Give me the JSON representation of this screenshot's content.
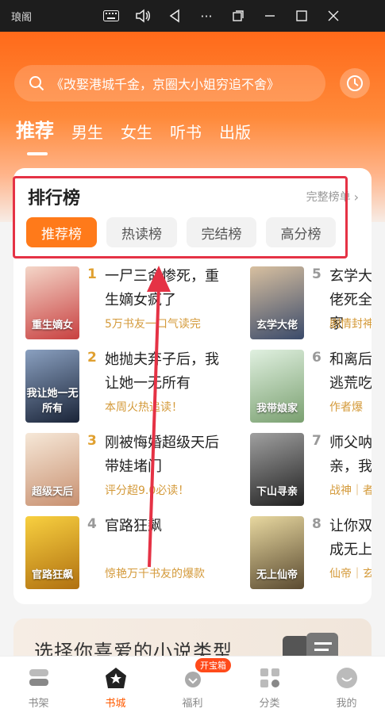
{
  "window": {
    "title": "琅阁",
    "buttons": {
      "keyboard": "keyboard-icon",
      "volume": "volume-icon",
      "back": "back-icon",
      "more": "···",
      "restore": "restore-icon",
      "minimize": "minimize-icon",
      "maximize": "maximize-icon",
      "close": "close-icon"
    }
  },
  "search": {
    "placeholder": "《改娶港城千金，京圈大小姐穷追不舍》"
  },
  "tabs": [
    "推荐",
    "男生",
    "女生",
    "听书",
    "出版"
  ],
  "ranking": {
    "title": "排行榜",
    "full_link": "完整榜单",
    "chips": [
      "推荐榜",
      "热读榜",
      "完结榜",
      "高分榜"
    ],
    "books": [
      {
        "rank": "1",
        "title": "一尸三命惨死，重生嫡女疯了",
        "tag": "5万书友一口气读完",
        "cover_text": "重生嫡女",
        "cover_color": "#c84040"
      },
      {
        "rank": "2",
        "title": "她抛夫弃子后，我让她一无所有",
        "tag": "本周火热追读！",
        "cover_text": "我让她一无所有",
        "cover_color": "#2a3a58"
      },
      {
        "rank": "3",
        "title": "刚被悔婚超级天后带娃堵门",
        "tag": "评分超9.0必读！",
        "cover_text": "超级天后",
        "cover_color": "#c89070"
      },
      {
        "rank": "4",
        "title": "官路狂飙",
        "tag": "惊艳万千书友的爆款",
        "cover_text": "官路狂飙",
        "cover_color": "#e0b020"
      },
      {
        "rank": "5",
        "title": "玄学大佬死全家",
        "tag": "剧情封神",
        "cover_text": "玄学大佬",
        "cover_color": "#3a4a6a"
      },
      {
        "rank": "6",
        "title": "和离后逃荒吃",
        "tag": "作者爆",
        "cover_text": "我带娘家",
        "cover_color": "#7aa070"
      },
      {
        "rank": "7",
        "title": "师父呐亲，我",
        "tag": "战神｜者",
        "cover_text": "下山寻亲",
        "cover_color": "#303030"
      },
      {
        "rank": "8",
        "title": "让你双成无上",
        "tag": "仙帝｜玄",
        "cover_text": "无上仙帝",
        "cover_color": "#5a4a30"
      }
    ]
  },
  "banner": {
    "text": "选择你喜爱的小说类型"
  },
  "nav": [
    {
      "label": "书架",
      "icon": "bookshelf-icon"
    },
    {
      "label": "书城",
      "icon": "bookstore-icon"
    },
    {
      "label": "福利",
      "icon": "gift-icon",
      "badge": "开宝箱"
    },
    {
      "label": "分类",
      "icon": "category-icon"
    },
    {
      "label": "我的",
      "icon": "profile-icon"
    }
  ],
  "colors": {
    "accent": "#ff7a1a",
    "highlight": "#e53245",
    "tag": "#d49a3a"
  }
}
